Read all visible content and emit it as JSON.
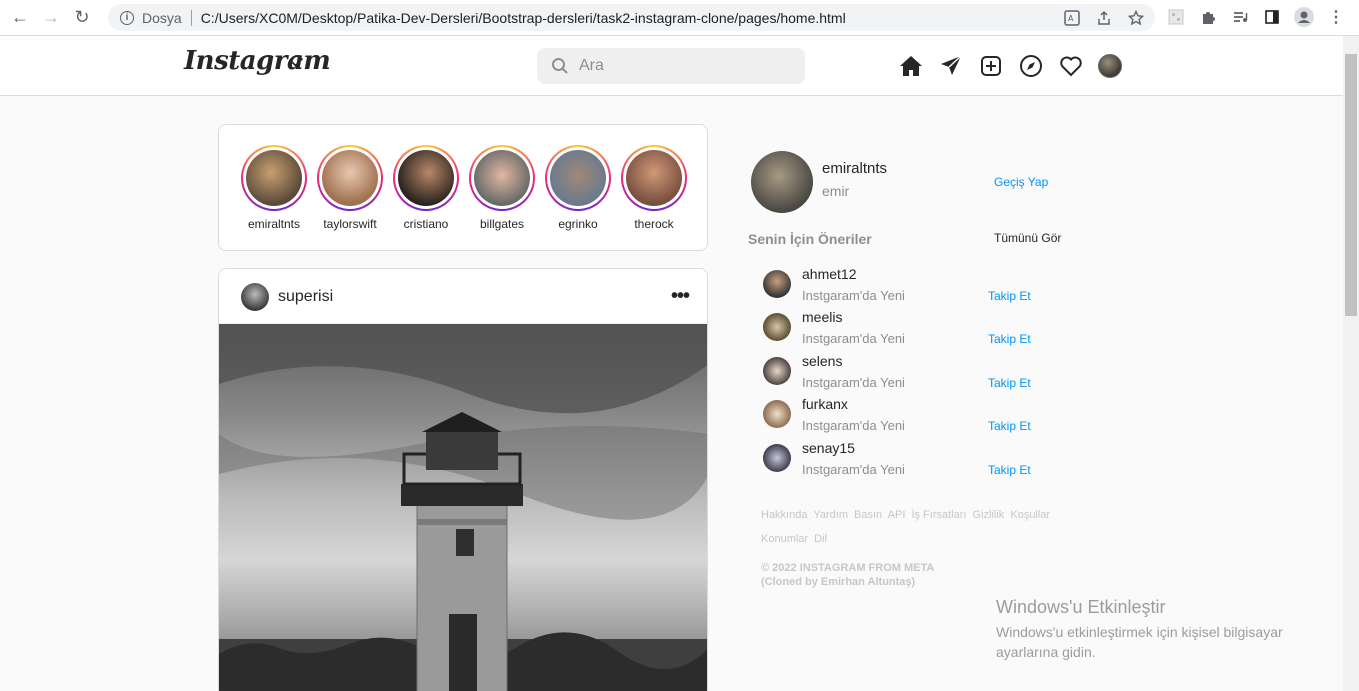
{
  "browser": {
    "dosya_label": "Dosya",
    "url": "C:/Users/XC0M/Desktop/Patika-Dev-Dersleri/Bootstrap-dersleri/task2-instagram-clone/pages/home.html"
  },
  "header": {
    "logo": "Instagram",
    "search_placeholder": "Ara"
  },
  "stories": [
    {
      "name": "emiraltnts",
      "color": "#7a6f60"
    },
    {
      "name": "taylorswift",
      "color": "#c9a48a"
    },
    {
      "name": "cristiano",
      "color": "#3b2e28"
    },
    {
      "name": "billgates",
      "color": "#8a7f78"
    },
    {
      "name": "egrinko",
      "color": "#6a7a8e"
    },
    {
      "name": "therock",
      "color": "#9a6a4e"
    }
  ],
  "post": {
    "username": "superisi",
    "more": "•••"
  },
  "profile": {
    "username": "emiraltnts",
    "name": "emir",
    "switch_label": "Geçiş Yap"
  },
  "suggestions": {
    "title": "Senin İçin Öneriler",
    "see_all": "Tümünü Gör",
    "items": [
      {
        "username": "ahmet12",
        "sub": "Instgaram'da Yeni",
        "action": "Takip Et"
      },
      {
        "username": "meelis",
        "sub": "Instgaram'da Yeni",
        "action": "Takip Et"
      },
      {
        "username": "selens",
        "sub": "Instgaram'da Yeni",
        "action": "Takip Et"
      },
      {
        "username": "furkanx",
        "sub": "Instgaram'da Yeni",
        "action": "Takip Et"
      },
      {
        "username": "senay15",
        "sub": "Instgaram'da Yeni",
        "action": "Takip Et"
      }
    ]
  },
  "footer": {
    "links": [
      "Hakkında",
      "Yardım",
      "Basın",
      "API",
      "İş Fırsatları",
      "Gizlilik",
      "Koşullar",
      "Konumlar",
      "Dil"
    ],
    "copyright_line1": "© 2022 INSTAGRAM FROM META",
    "copyright_line2": "(Cloned by Emirhan Altuntaş)"
  },
  "windows_activation": {
    "title": "Windows'u Etkinleştir",
    "text": "Windows'u etkinleştirmek için kişisel bilgisayar ayarlarına gidin."
  }
}
